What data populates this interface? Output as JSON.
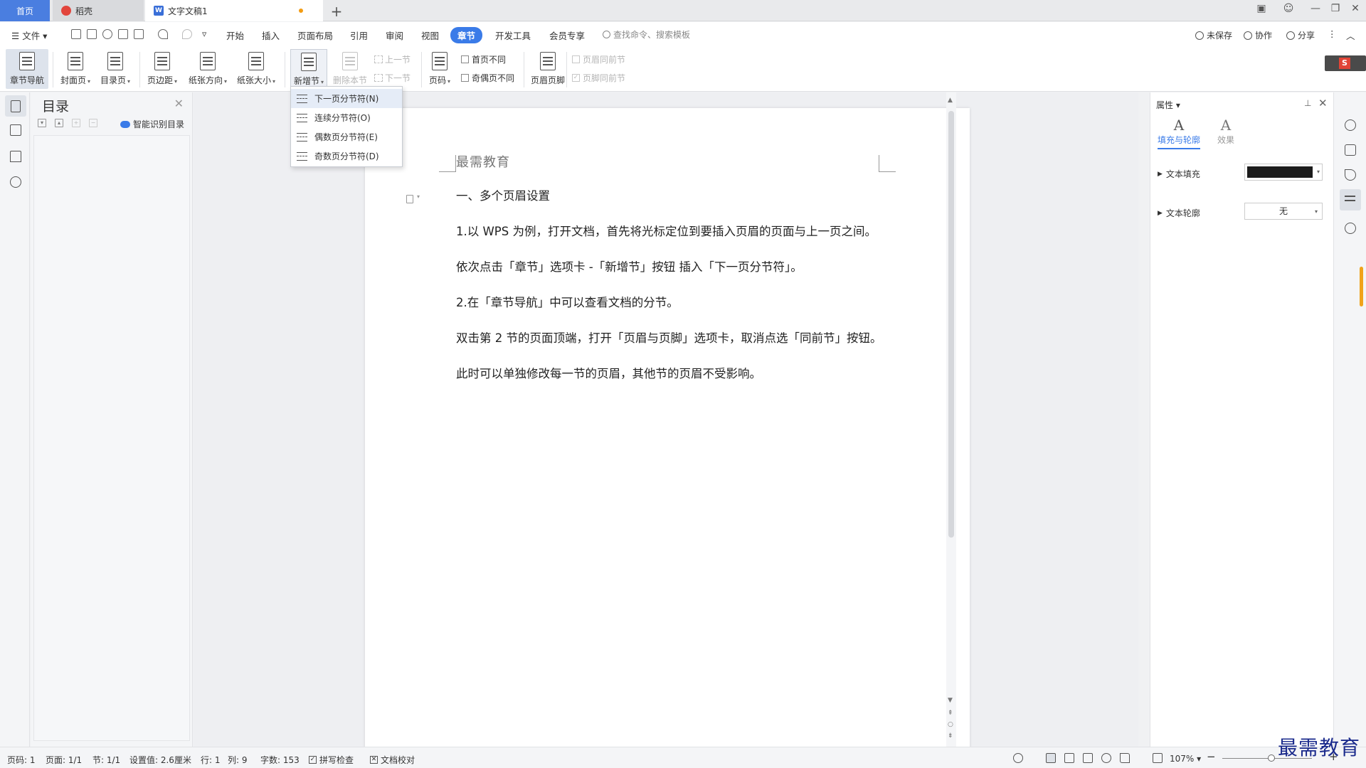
{
  "tabs": {
    "home": "首页",
    "docer": "稻壳",
    "document": "文字文稿1"
  },
  "menu": {
    "file": "文件",
    "items": [
      "开始",
      "插入",
      "页面布局",
      "引用",
      "审阅",
      "视图",
      "章节",
      "开发工具",
      "会员专享"
    ],
    "active": "章节",
    "search_placeholder": "查找命令、搜索模板",
    "unsaved": "未保存",
    "collab": "协作",
    "share": "分享"
  },
  "ribbon": {
    "chapter_nav": "章节导航",
    "cover": "封面页",
    "toc_page": "目录页",
    "margins": "页边距",
    "orientation": "纸张方向",
    "paper_size": "纸张大小",
    "new_section": "新增节",
    "delete_section": "删除本节",
    "prev_section": "上一节",
    "next_section": "下一节",
    "page_number": "页码",
    "first_page_diff": "首页不同",
    "odd_even_diff": "奇偶页不同",
    "header_footer": "页眉页脚",
    "header_same_prev": "页眉同前节",
    "footer_same_prev": "页脚同前节"
  },
  "dropdown": {
    "items": [
      "下一页分节符(N)",
      "连续分节符(O)",
      "偶数页分节符(E)",
      "奇数页分节符(D)"
    ]
  },
  "toc": {
    "title": "目录",
    "smart": "智能识别目录"
  },
  "document": {
    "header": "最需教育",
    "lines": [
      "一、多个页眉设置",
      "1.以 WPS 为例，打开文档，首先将光标定位到要插入页眉的页面与上一页之间。",
      "依次点击「章节」选项卡 -「新增节」按钮 插入「下一页分节符」。",
      "2.在「章节导航」中可以查看文档的分节。",
      "双击第 2 节的页面顶端，打开「页眉与页脚」选项卡，取消点选「同前节」按钮。",
      "此时可以单独修改每一节的页眉，其他节的页眉不受影响。"
    ]
  },
  "properties": {
    "title": "属性",
    "tab_fill": "填充与轮廓",
    "tab_effect": "效果",
    "text_fill": "文本填充",
    "text_outline": "文本轮廓",
    "outline_value": "无",
    "fill_color": "#1b1b1b"
  },
  "status": {
    "page_code": "页码: 1",
    "page": "页面: 1/1",
    "section": "节: 1/1",
    "setting": "设置值: 2.6厘米",
    "row": "行: 1",
    "col": "列: 9",
    "words": "字数: 153",
    "spellcheck": "拼写检查",
    "proofread": "文档校对",
    "zoom": "107%"
  },
  "watermark": "最需教育"
}
